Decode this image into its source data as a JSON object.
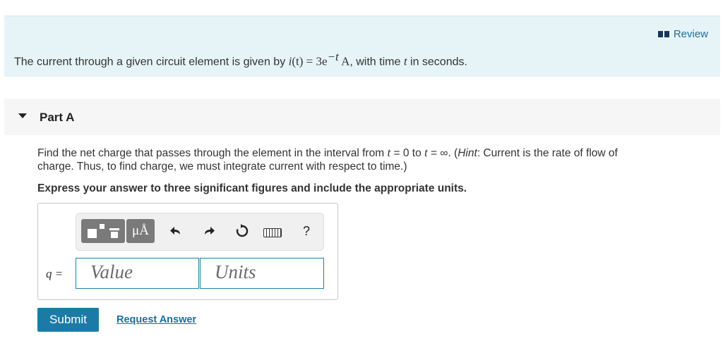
{
  "intro": {
    "review_label": "Review",
    "text_before": "The current through a given circuit element is given by ",
    "math_lhs": "i",
    "math_arg": "(t)",
    "math_rhs": " = 3e",
    "math_exp": "−t",
    "math_unit": " A",
    "text_mid": ", with time ",
    "text_var": "t",
    "text_after": " in seconds."
  },
  "part": {
    "title": "Part A",
    "q_line1_a": "Find the net charge that passes through the element in the interval from ",
    "q_t1": "t",
    "q_eq1": " = 0 to ",
    "q_t2": "t",
    "q_eq2": " = ∞. (",
    "q_hint": "Hint",
    "q_line1_b": ": Current is the rate of flow of",
    "q_line2": "charge. Thus, to find charge, we must integrate current with respect to time.)",
    "instruction": "Express your answer to three significant figures and include the appropriate units."
  },
  "answer": {
    "var_label": "q =",
    "value_placeholder": "Value",
    "units_placeholder": "Units",
    "units_symbol": "μÅ"
  },
  "toolbar_icons": [
    "templates-icon",
    "units-icon",
    "undo-icon",
    "redo-icon",
    "reset-icon",
    "keyboard-icon",
    "help-icon"
  ],
  "help_glyph": "?",
  "actions": {
    "submit_label": "Submit",
    "request_label": "Request Answer"
  },
  "colors": {
    "intro_bg": "#e6f4f7",
    "accent": "#1c7ba6",
    "link": "#1b6f9b"
  }
}
